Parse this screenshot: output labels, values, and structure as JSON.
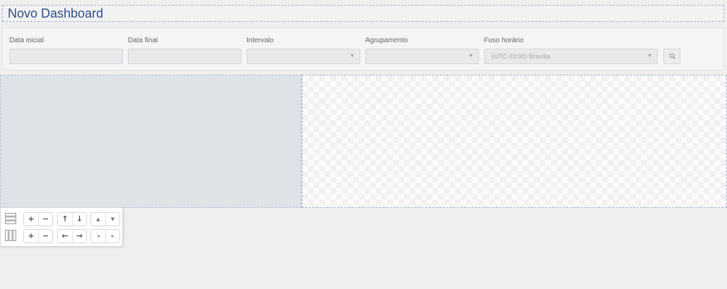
{
  "dashboard": {
    "title": "Novo Dashboard"
  },
  "filters": {
    "start_date": {
      "label": "Data inicial",
      "value": ""
    },
    "end_date": {
      "label": "Data final",
      "value": ""
    },
    "interval": {
      "label": "Intervalo",
      "value": ""
    },
    "grouping": {
      "label": "Agrupamento",
      "value": ""
    },
    "timezone": {
      "label": "Fuso horário",
      "value": "(UTC-03:00) Brasília"
    }
  },
  "toolbox": {
    "rows": {
      "add": "+",
      "remove": "−",
      "move_up": "↑",
      "move_down": "↓",
      "shrink": "▲",
      "grow": "▼"
    },
    "cols": {
      "add": "+",
      "remove": "−",
      "move_left": "←",
      "move_right": "→",
      "shrink": "◂",
      "grow": "▸"
    }
  }
}
